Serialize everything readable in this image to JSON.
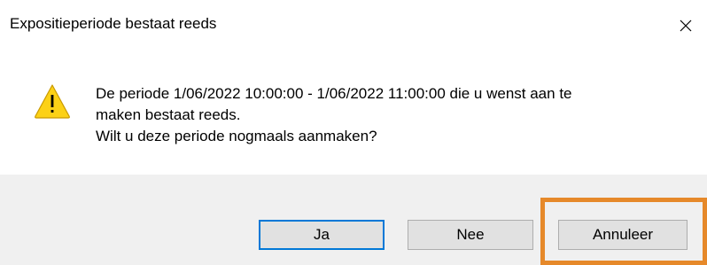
{
  "dialog": {
    "title": "Expositieperiode bestaat reeds",
    "icon": "warning-icon",
    "message_lines": [
      "De periode 1/06/2022 10:00:00 - 1/06/2022 11:00:00 die u wenst aan te",
      "maken bestaat reeds.",
      "Wilt u deze periode nogmaals aanmaken?"
    ]
  },
  "buttons": {
    "yes_label": "Ja",
    "no_label": "Nee",
    "cancel_label": "Annuleer"
  },
  "colors": {
    "warning_fill": "#fcd116",
    "default_button_border": "#0078d7",
    "highlight_outline": "#e6892a",
    "footer_background": "#f0f0f0"
  }
}
